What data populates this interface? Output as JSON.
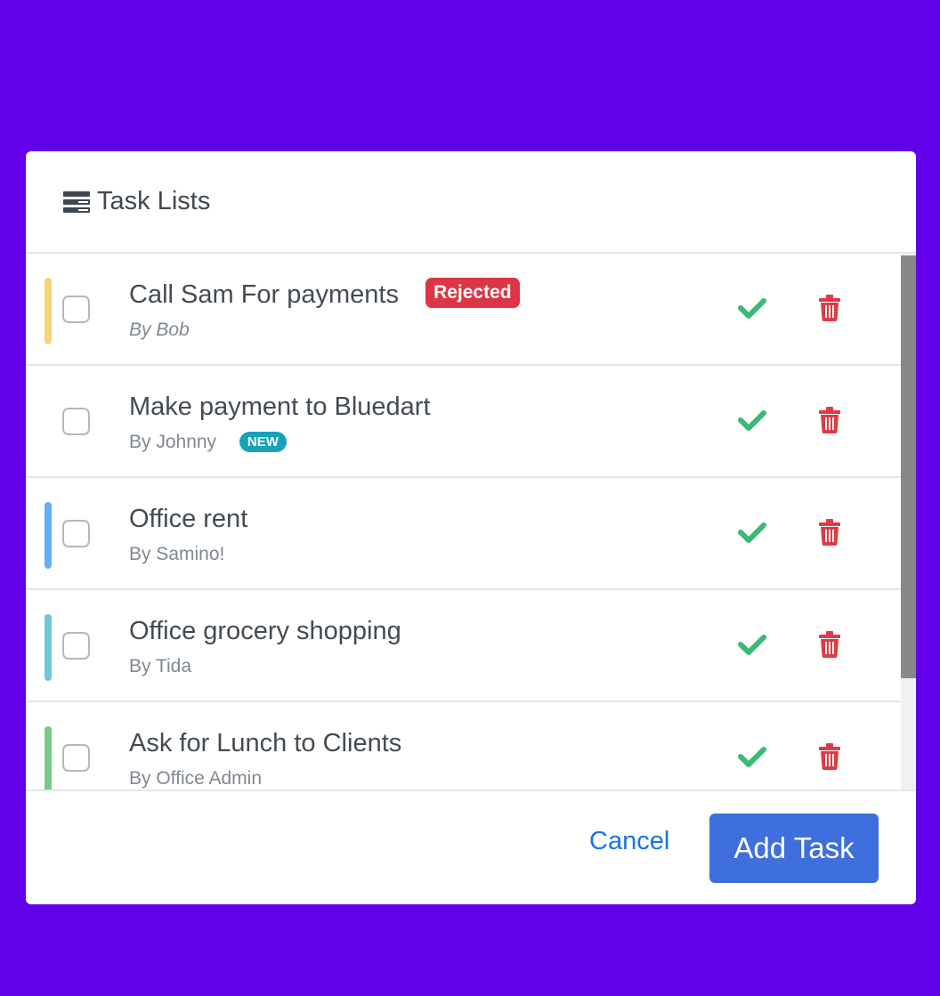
{
  "header": {
    "title": "Task Lists",
    "icon": "server-icon"
  },
  "tasks": [
    {
      "title": "Call Sam For payments",
      "author": "By Bob",
      "author_italic": true,
      "badge": "Rejected",
      "badge_type": "rejected",
      "accent_color": "#f8d37a"
    },
    {
      "title": "Make payment to Bluedart",
      "author": "By Johnny",
      "author_italic": false,
      "badge": "NEW",
      "badge_type": "new",
      "accent_color": ""
    },
    {
      "title": "Office rent",
      "author": "By Samino!",
      "author_italic": false,
      "badge": "",
      "badge_type": "",
      "accent_color": "#67aef5"
    },
    {
      "title": "Office grocery shopping",
      "author": "By Tida",
      "author_italic": false,
      "badge": "",
      "badge_type": "",
      "accent_color": "#6fc8d6"
    },
    {
      "title": "Ask for Lunch to Clients",
      "author": "By Office Admin",
      "author_italic": false,
      "badge": "",
      "badge_type": "",
      "accent_color": "#78c98a"
    }
  ],
  "actions": {
    "complete_icon": "check-icon",
    "delete_icon": "trash-icon",
    "complete_color": "#3cb878",
    "delete_color": "#e03a45"
  },
  "footer": {
    "cancel_label": "Cancel",
    "add_label": "Add Task"
  },
  "colors": {
    "background": "#6200ea",
    "primary": "#3e6fdc",
    "link": "#1a73e8"
  }
}
